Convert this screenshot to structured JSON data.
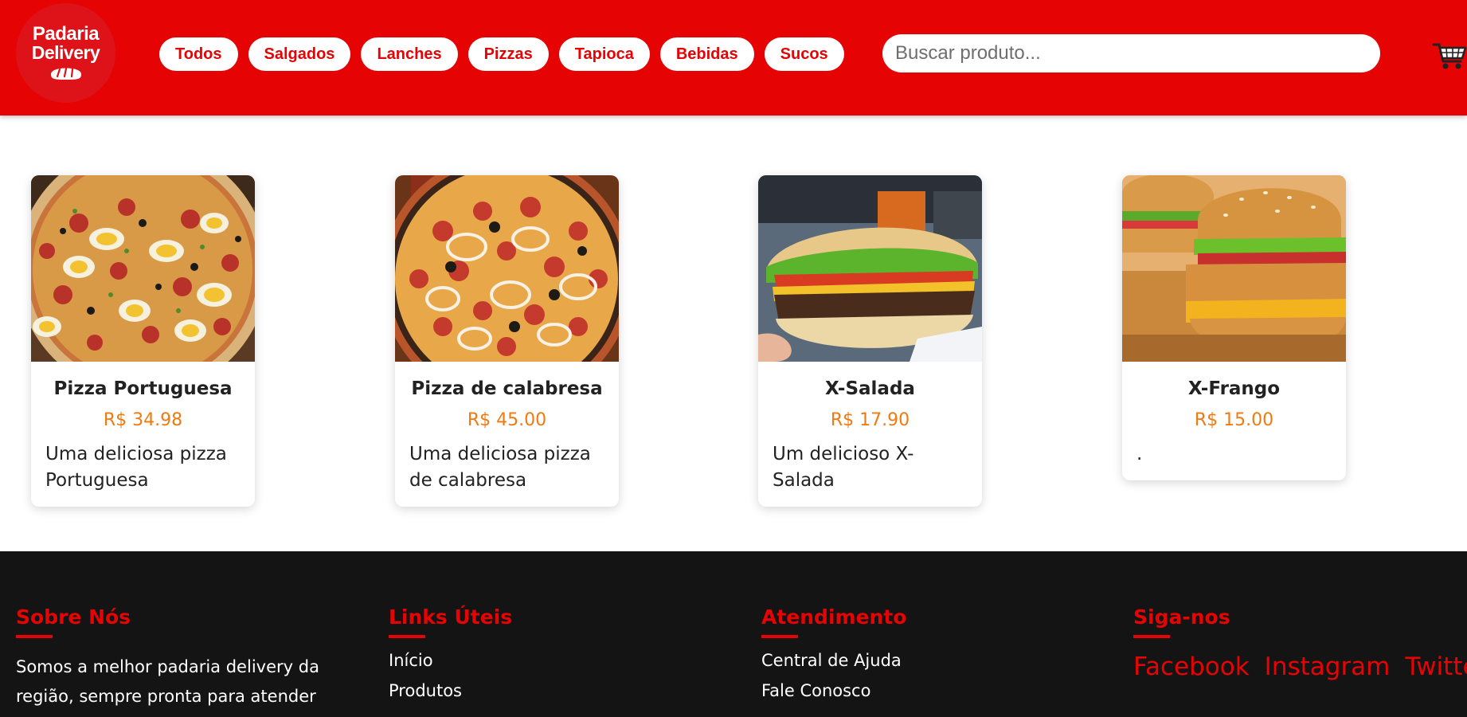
{
  "logo": {
    "line1": "Padaria",
    "line2": "Delivery"
  },
  "nav": [
    {
      "label": "Todos"
    },
    {
      "label": "Salgados"
    },
    {
      "label": "Lanches"
    },
    {
      "label": "Pizzas"
    },
    {
      "label": "Tapioca"
    },
    {
      "label": "Bebidas"
    },
    {
      "label": "Sucos"
    }
  ],
  "search": {
    "placeholder": "Buscar produto...",
    "value": ""
  },
  "cart": {
    "icon": "cart-icon"
  },
  "products": [
    {
      "name": "Pizza Portuguesa",
      "price": "R$ 34.98",
      "description": "Uma deliciosa pizza Portuguesa",
      "image": "pizza-portuguesa-image"
    },
    {
      "name": "Pizza de calabresa",
      "price": "R$ 45.00",
      "description": "Uma deliciosa pizza de calabresa",
      "image": "pizza-calabresa-image"
    },
    {
      "name": "X-Salada",
      "price": "R$ 17.90",
      "description": "Um delicioso X-Salada",
      "image": "x-salada-image"
    },
    {
      "name": "X-Frango",
      "price": "R$ 15.00",
      "description": ".",
      "image": "x-frango-image"
    }
  ],
  "footer": {
    "about": {
      "title": "Sobre Nós",
      "text": "Somos a melhor padaria delivery da região, sempre pronta para atender você!"
    },
    "links": {
      "title": "Links Úteis",
      "items": [
        "Início",
        "Produtos"
      ]
    },
    "support": {
      "title": "Atendimento",
      "items": [
        "Central de Ajuda",
        "Fale Conosco"
      ]
    },
    "social": {
      "title": "Siga-nos",
      "items": [
        "Facebook",
        "Instagram",
        "Twitter"
      ]
    }
  },
  "colors": {
    "brand_red": "#e50304",
    "price_orange": "#f07a10",
    "footer_bg": "#141414"
  }
}
